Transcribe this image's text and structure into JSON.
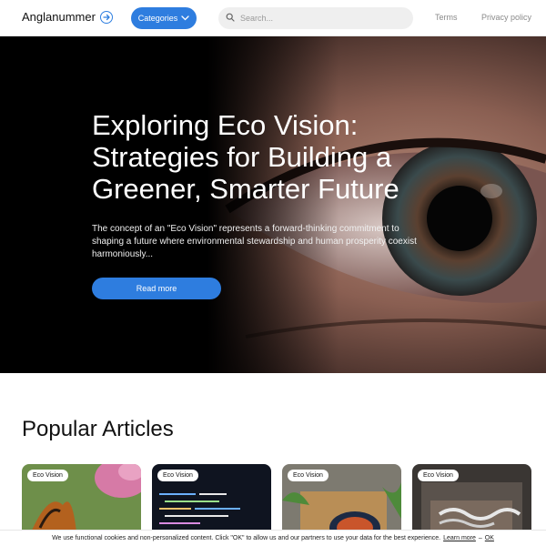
{
  "header": {
    "logo_text": "Anglanummer",
    "categories_label": "Categories",
    "search_placeholder": "Search...",
    "links": [
      "Terms",
      "Privacy policy"
    ]
  },
  "hero": {
    "title": "Exploring Eco Vision: Strategies for Building a Greener, Smarter Future",
    "description": "The concept of an \"Eco Vision\" represents a forward-thinking commitment to shaping a future where environmental stewardship and human prosperity coexist harmoniously...",
    "button_label": "Read more"
  },
  "popular": {
    "title": "Popular Articles",
    "cards": [
      {
        "badge": "Eco Vision"
      },
      {
        "badge": "Eco Vision"
      },
      {
        "badge": "Eco Vision"
      },
      {
        "badge": "Eco Vision"
      }
    ]
  },
  "cookie": {
    "text": "We use functional cookies and non-personalized content. Click \"OK\" to allow us and our partners to use your data for the best experience.",
    "learn_more": "Learn more",
    "separator": "–",
    "ok": "OK"
  },
  "colors": {
    "accent": "#2e7ddf"
  }
}
